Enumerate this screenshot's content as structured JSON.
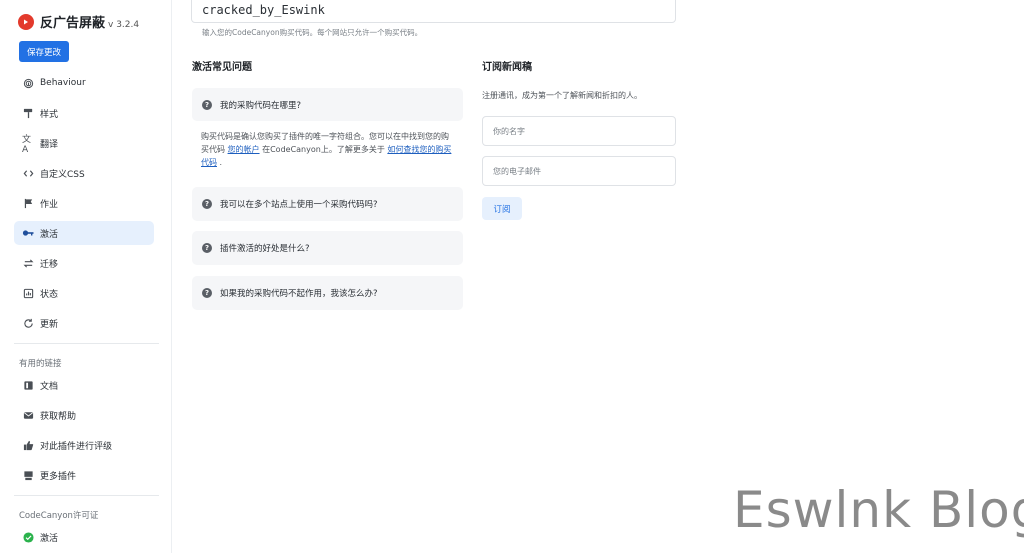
{
  "app": {
    "title": "反广告屏蔽",
    "version": "v 3.2.4",
    "save_label": "保存更改"
  },
  "sidebar": {
    "items": [
      {
        "label": "Behaviour",
        "icon": "fingerprint-icon"
      },
      {
        "label": "样式",
        "icon": "paint-roller-icon"
      },
      {
        "label": "翻译",
        "icon": "translate-icon"
      },
      {
        "label": "自定义CSS",
        "icon": "code-icon"
      },
      {
        "label": "作业",
        "icon": "flag-icon"
      },
      {
        "label": "激活",
        "icon": "key-icon",
        "active": true
      },
      {
        "label": "迁移",
        "icon": "swap-icon"
      },
      {
        "label": "状态",
        "icon": "status-icon"
      },
      {
        "label": "更新",
        "icon": "refresh-icon"
      }
    ],
    "links_section": "有用的链接",
    "links": [
      {
        "label": "文档",
        "icon": "docs-icon"
      },
      {
        "label": "获取帮助",
        "icon": "mail-icon"
      },
      {
        "label": "对此插件进行评级",
        "icon": "thumbs-up-icon"
      },
      {
        "label": "更多插件",
        "icon": "store-icon"
      }
    ],
    "license_section": "CodeCanyon许可证",
    "license_status": "激活"
  },
  "main": {
    "purchase_code_value": "cracked_by_Eswink",
    "purchase_code_hint": "输入您的CodeCanyon购买代码。每个网站只允许一个购买代码。",
    "faq_title": "激活常见问题",
    "faq": [
      {
        "question": "我的采购代码在哪里?"
      },
      {
        "question": "我可以在多个站点上使用一个采购代码吗?"
      },
      {
        "question": "插件激活的好处是什么?"
      },
      {
        "question": "如果我的采购代码不起作用，我该怎么办?"
      }
    ],
    "faq_answer": {
      "part1": "购买代码是确认您购买了插件的唯一字符组合。您可以在中找到您的购买代码",
      "link1": "您的帐户",
      "part2": "在CodeCanyon上。了解更多关于",
      "link2": "如何查找您的购买代码",
      "part3": "."
    },
    "newsletter": {
      "title": "订阅新闻稿",
      "description": "注册通讯，成为第一个了解新闻和折扣的人。",
      "name_placeholder": "你的名字",
      "email_placeholder": "您的电子邮件",
      "subscribe_label": "订阅"
    }
  },
  "watermark": "Eswlnk Blog",
  "colors": {
    "accent": "#2271e4",
    "active_bg": "#e6f0fd",
    "card_bg": "#f5f6f8",
    "success": "#2bb24c",
    "brand": "#e33a2c"
  }
}
